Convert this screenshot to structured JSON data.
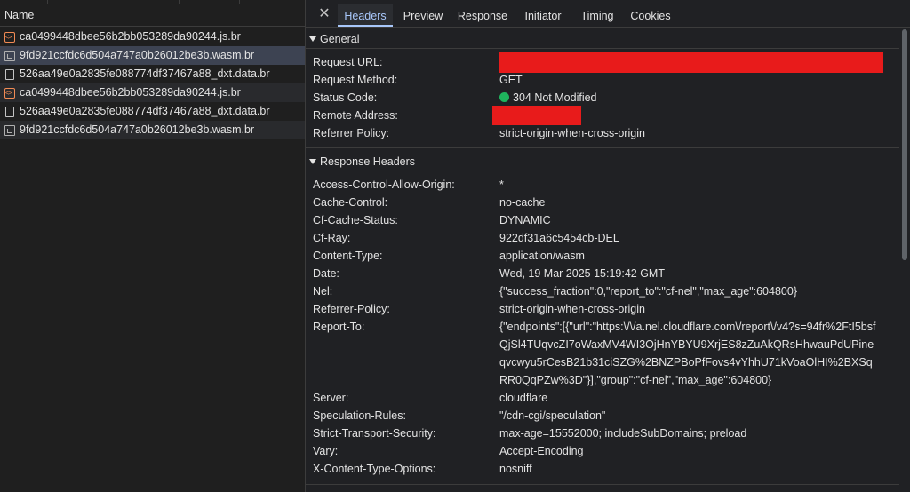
{
  "left": {
    "header": "Name",
    "rows": [
      {
        "name": "ca0499448dbee56b2bb053289da90244.js.br",
        "icon": "js-file-icon"
      },
      {
        "name": "9fd921ccfdc6d504a747a0b26012be3b.wasm.br",
        "icon": "wasm-file-icon"
      },
      {
        "name": "526aa49e0a2835fe088774df37467a88_dxt.data.br",
        "icon": "document-icon"
      },
      {
        "name": "ca0499448dbee56b2bb053289da90244.js.br",
        "icon": "js-file-icon"
      },
      {
        "name": "526aa49e0a2835fe088774df37467a88_dxt.data.br",
        "icon": "document-icon"
      },
      {
        "name": "9fd921ccfdc6d504a747a0b26012be3b.wasm.br",
        "icon": "wasm-file-icon"
      }
    ]
  },
  "tabs": [
    "Headers",
    "Preview",
    "Response",
    "Initiator",
    "Timing",
    "Cookies"
  ],
  "close_icon": "✕",
  "general": {
    "title": "General",
    "rows": [
      {
        "key": "Request URL:",
        "value": ""
      },
      {
        "key": "Request Method:",
        "value": "GET"
      },
      {
        "key": "Status Code:",
        "value": "304 Not Modified"
      },
      {
        "key": "Remote Address:",
        "value": ""
      },
      {
        "key": "Referrer Policy:",
        "value": "strict-origin-when-cross-origin"
      }
    ]
  },
  "response": {
    "title": "Response Headers",
    "rows": [
      {
        "key": "Access-Control-Allow-Origin:",
        "value": "*"
      },
      {
        "key": "Cache-Control:",
        "value": "no-cache"
      },
      {
        "key": "Cf-Cache-Status:",
        "value": "DYNAMIC"
      },
      {
        "key": "Cf-Ray:",
        "value": "922df31a6c5454cb-DEL"
      },
      {
        "key": "Content-Type:",
        "value": "application/wasm"
      },
      {
        "key": "Date:",
        "value": "Wed, 19 Mar 2025 15:19:42 GMT"
      },
      {
        "key": "Nel:",
        "value": "{\"success_fraction\":0,\"report_to\":\"cf-nel\",\"max_age\":604800}"
      },
      {
        "key": "Referrer-Policy:",
        "value": "strict-origin-when-cross-origin"
      },
      {
        "key": "Report-To:",
        "value": "{\"endpoints\":[{\"url\":\"https:\\/\\/a.nel.cloudflare.com\\/report\\/v4?s=94fr%2FtI5bsfQjSl4TUqvcZI7oWaxMV4WI3OjHnYBYU9XrjES8zZuAkQRsHhwauPdUPineqvcwyu5rCesB21b31ciSZG%2BNZPBoPfFovs4vYhhU71kVoaOlHI%2BXSqRR0QqPZw%3D\"}],\"group\":\"cf-nel\",\"max_age\":604800}"
      },
      {
        "key": "Server:",
        "value": "cloudflare"
      },
      {
        "key": "Speculation-Rules:",
        "value": "\"/cdn-cgi/speculation\""
      },
      {
        "key": "Strict-Transport-Security:",
        "value": "max-age=15552000; includeSubDomains; preload"
      },
      {
        "key": "Vary:",
        "value": "Accept-Encoding"
      },
      {
        "key": "X-Content-Type-Options:",
        "value": "nosniff"
      }
    ]
  },
  "colors": {
    "accent": "#a8c7fa",
    "status_ok": "#1fb45d",
    "redaction": "#e81b1b"
  }
}
